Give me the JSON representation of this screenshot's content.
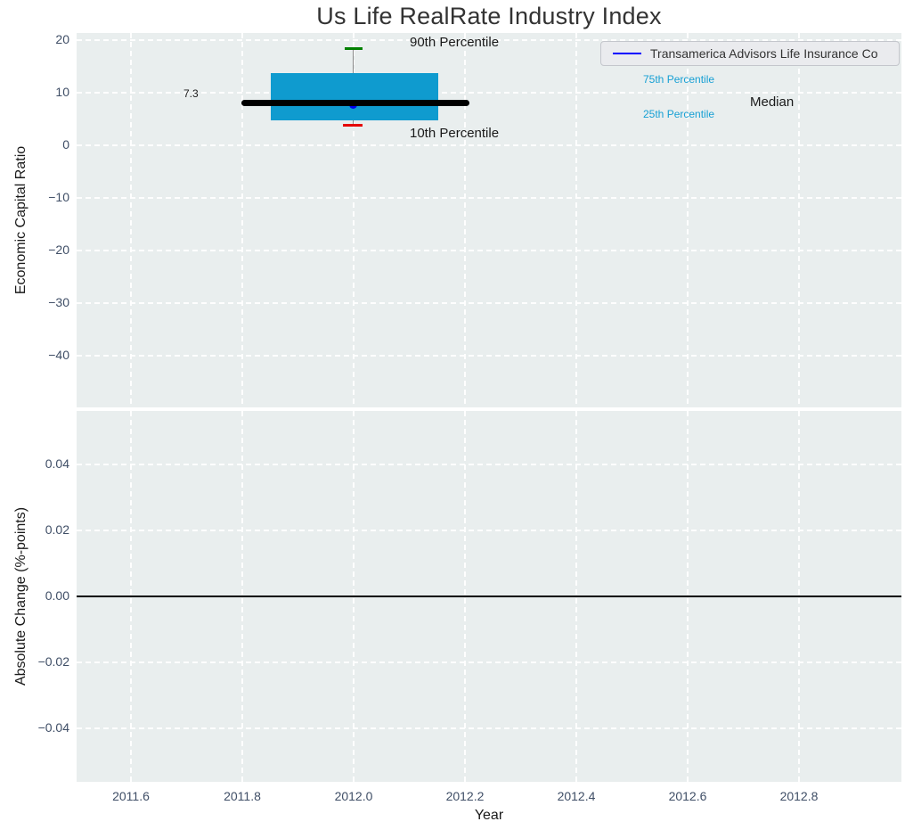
{
  "title": "Us Life RealRate Industry Index",
  "legend": {
    "label": "Transamerica Advisors Life Insurance Co",
    "line_color": "#0000ff"
  },
  "top_axis": {
    "ylabel": "Economic Capital Ratio",
    "yticks": [
      "20",
      "10",
      "0",
      "−10",
      "−20",
      "−30",
      "−40"
    ],
    "annotations": {
      "p90": "90th Percentile",
      "p10": "10th Percentile",
      "p75": "75th Percentile",
      "p25": "25th Percentile",
      "median": "Median",
      "median_value": "7.3"
    }
  },
  "bottom_axis": {
    "ylabel": "Absolute Change (%-points)",
    "yticks": [
      "0.04",
      "0.02",
      "0.00",
      "−0.02",
      "−0.04"
    ]
  },
  "x_axis": {
    "label": "Year",
    "ticks": [
      "2011.6",
      "2011.8",
      "2012.0",
      "2012.2",
      "2012.4",
      "2012.6",
      "2012.8"
    ]
  },
  "colors": {
    "plot_background": "#e9eeee",
    "grid": "#ffffff",
    "tick_label": "#3f4e66",
    "box_fill": "#0f9bcf",
    "median_line": "#000000",
    "whisker": "#8a8a8a",
    "cap_90th": "#008000",
    "cap_10th": "#e50000",
    "company_marker": "#0000ee",
    "legend_line": "#0000ff",
    "cyan_label": "#17a0d4"
  },
  "chart_data": [
    {
      "type": "boxplot",
      "title": "Us Life RealRate Industry Index",
      "xlabel": "Year",
      "ylabel": "Economic Capital Ratio",
      "boxes": [
        {
          "x": 2012.0,
          "p10": 2.9,
          "p25": 3.9,
          "median": 7.3,
          "p75": 12.7,
          "p90": 17.5,
          "box_width": 0.3,
          "median_line_half_width": 0.2
        }
      ],
      "points": [
        {
          "name": "Transamerica Advisors Life Insurance Co",
          "x": 2012.0,
          "y": 7.3,
          "color": "#0000ff"
        }
      ],
      "median_label": "7.3",
      "xlim": [
        2011.5,
        2012.98
      ],
      "ylim": [
        -50,
        21
      ],
      "xticks": [
        2011.6,
        2011.8,
        2012.0,
        2012.2,
        2012.4,
        2012.6,
        2012.8
      ],
      "yticks": [
        20,
        10,
        0,
        -10,
        -20,
        -30,
        -40
      ],
      "grid": true,
      "legend": [
        "Transamerica Advisors Life Insurance Co"
      ],
      "legend_position": "upper right",
      "annotations": [
        "90th Percentile",
        "10th Percentile",
        "75th Percentile",
        "25th Percentile",
        "Median",
        "7.3"
      ]
    },
    {
      "type": "line",
      "xlabel": "Year",
      "ylabel": "Absolute Change (%-points)",
      "series": [
        {
          "name": "zero-baseline",
          "x": [
            2011.5,
            2012.98
          ],
          "y": [
            0,
            0
          ],
          "color": "#000000"
        }
      ],
      "xticks": [
        2011.6,
        2011.8,
        2012.0,
        2012.2,
        2012.4,
        2012.6,
        2012.8
      ],
      "yticks": [
        0.04,
        0.02,
        0.0,
        -0.02,
        -0.04
      ],
      "ylim": [
        -0.057,
        0.056
      ],
      "grid": true
    }
  ]
}
